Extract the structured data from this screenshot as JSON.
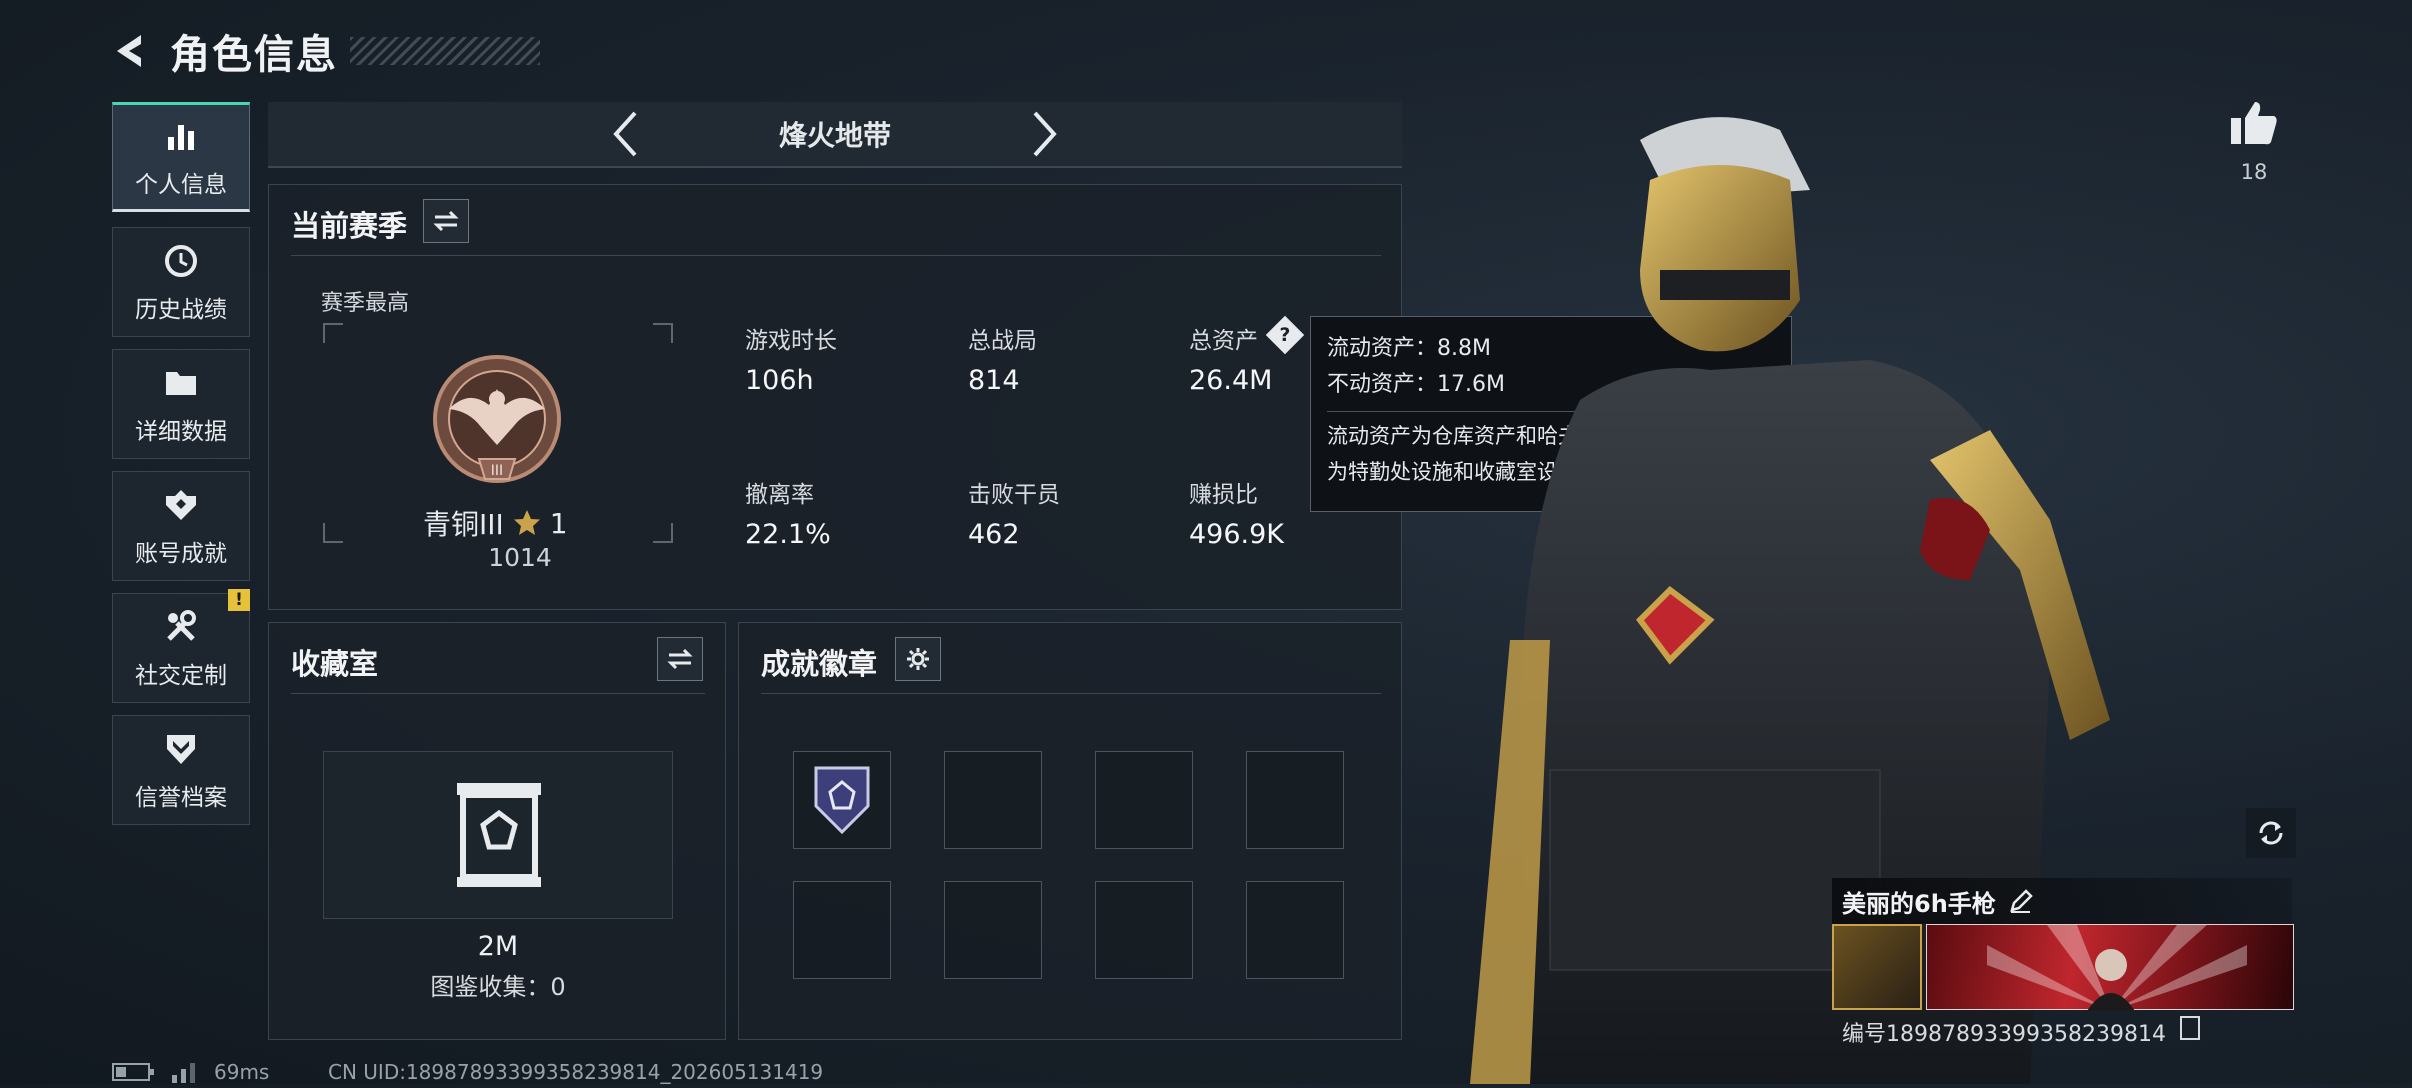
{
  "header": {
    "title": "角色信息"
  },
  "sidebar": {
    "items": [
      {
        "label": "个人信息",
        "icon": "bar-chart-icon",
        "active": true
      },
      {
        "label": "历史战绩",
        "icon": "history-clock-icon"
      },
      {
        "label": "详细数据",
        "icon": "folder-icon"
      },
      {
        "label": "账号成就",
        "icon": "achievement-icon"
      },
      {
        "label": "社交定制",
        "icon": "tools-icon",
        "badge": "!"
      },
      {
        "label": "信誉档案",
        "icon": "shield-chevron-icon"
      }
    ]
  },
  "mode_selector": {
    "label": "烽火地带"
  },
  "season": {
    "title": "当前赛季",
    "best_label": "赛季最高",
    "rank_name": "青铜III",
    "rank_stars": "1",
    "rank_points": "1014",
    "stats": [
      {
        "label": "游戏时长",
        "value": "106h"
      },
      {
        "label": "总战局",
        "value": "814"
      },
      {
        "label": "总资产",
        "value": "26.4M",
        "has_help": true
      },
      {
        "label": "撤离率",
        "value": "22.1%"
      },
      {
        "label": "击败干员",
        "value": "462"
      },
      {
        "label": "赚损比",
        "value": "496.9K"
      }
    ],
    "help_symbol": "?"
  },
  "tooltip": {
    "liquid": "流动资产：8.8M",
    "fixed": "不动资产：17.6M",
    "desc_line1": "流动资产为仓库资产和哈夫币，不动资产",
    "desc_line2": "为特勤处设施和收藏室设施"
  },
  "collection": {
    "title": "收藏室",
    "value": "2M",
    "catalog": "图鉴收集：0"
  },
  "badges": {
    "title": "成就徽章",
    "slots": 8,
    "filled": 1
  },
  "right_panel": {
    "likes": "18",
    "weapon_name": "美丽的6h手枪",
    "id_text": "编号18987893399358239814"
  },
  "status_bar": {
    "ping": "69ms",
    "uid": "CN UID:18987893399358239814_202605131419"
  },
  "colors": {
    "accent_teal": "#49d6b3",
    "badge_yellow": "#e8c13a",
    "gold": "#c9a24a",
    "red": "#c0262d"
  }
}
